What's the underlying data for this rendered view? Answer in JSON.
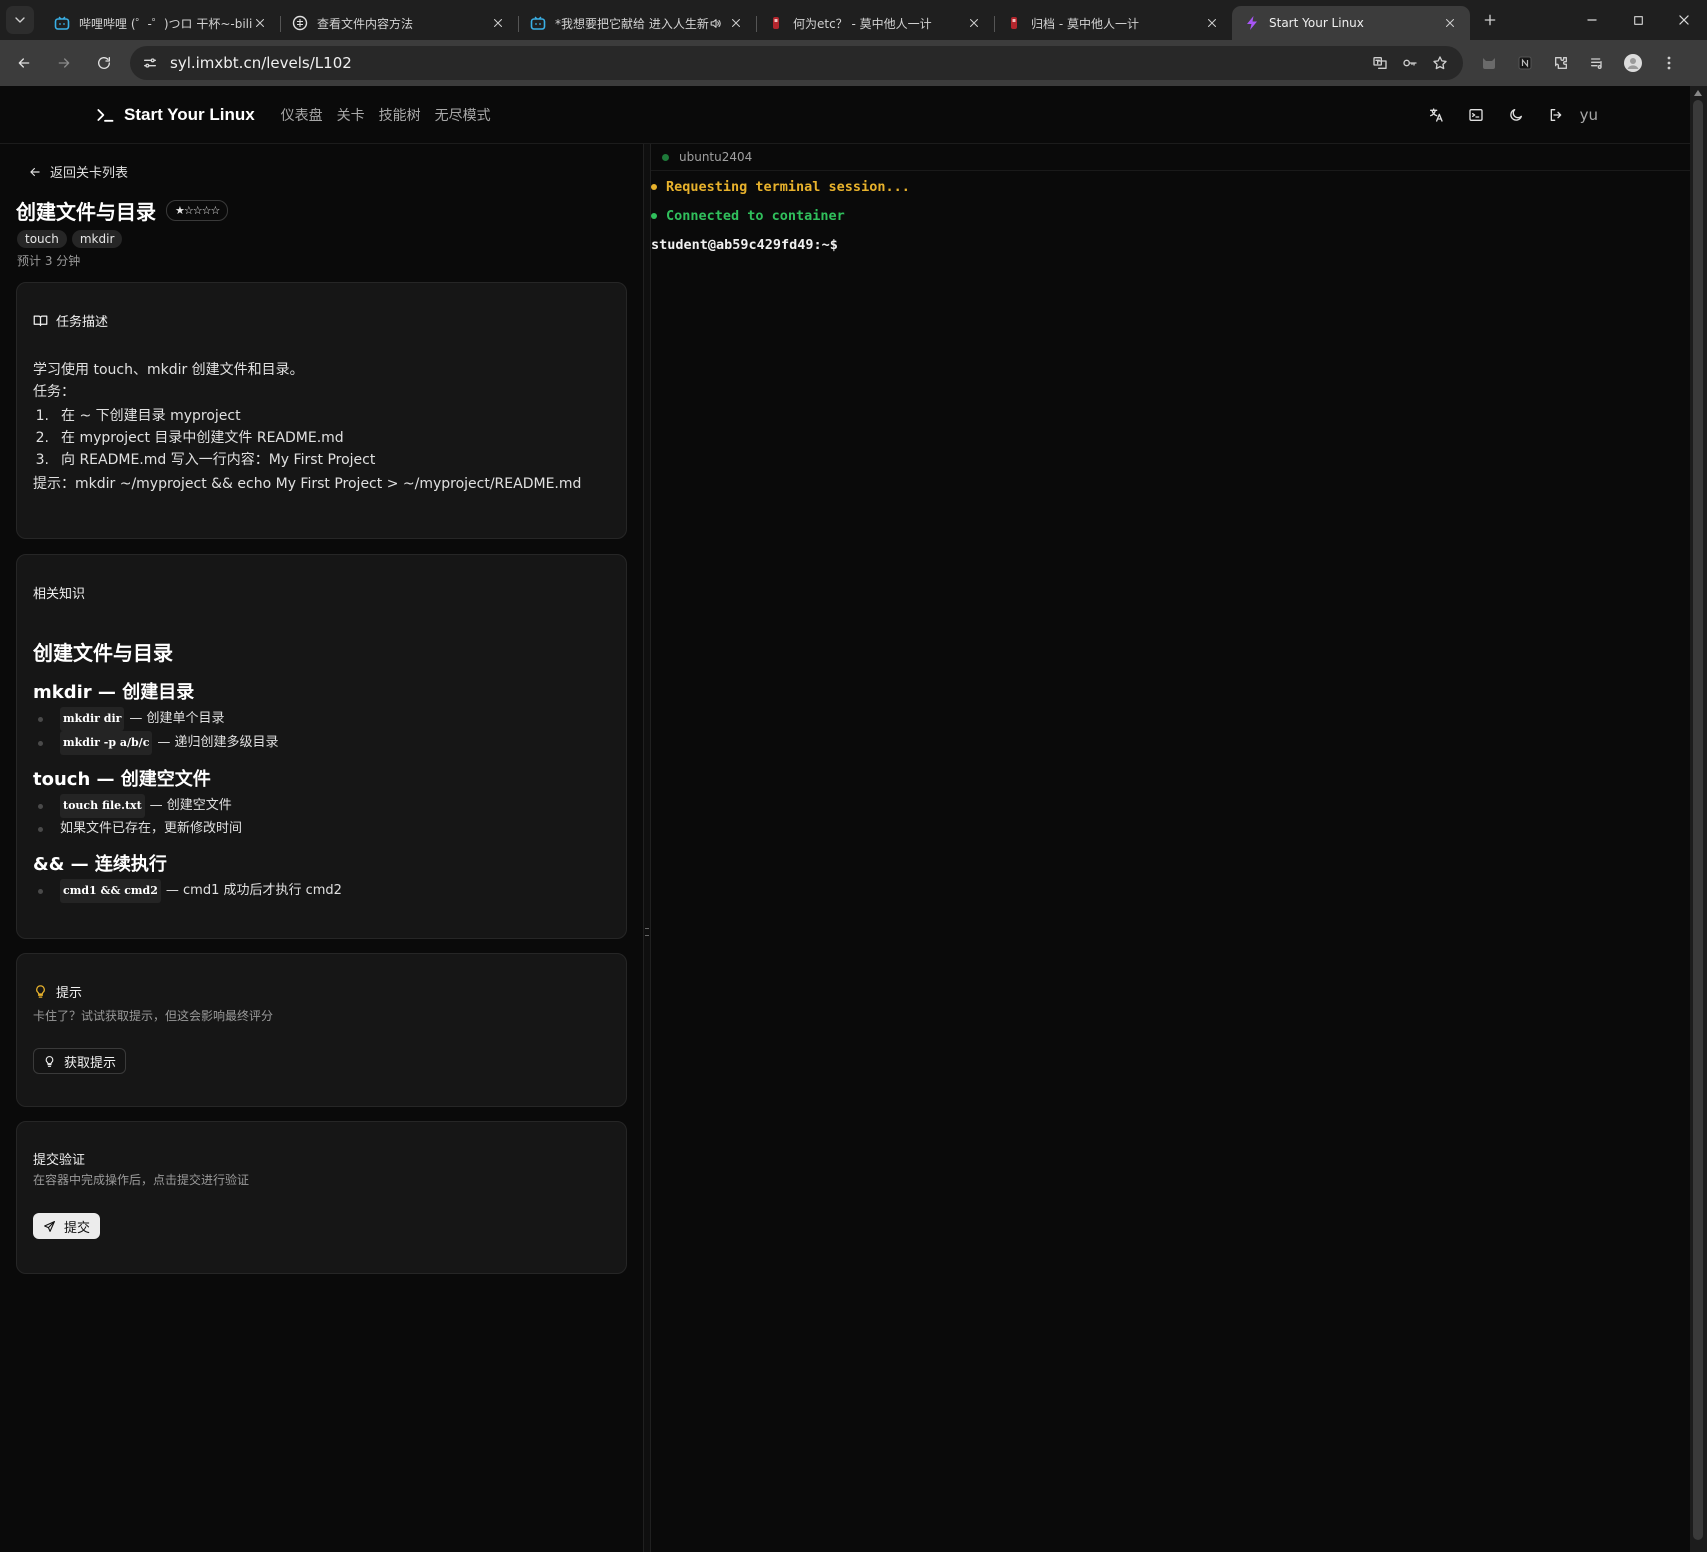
{
  "browser": {
    "tabs": [
      {
        "title": "哔哩哔哩 (゜-゜)つロ 干杯~-bilibili",
        "icon": "bilibili-icon",
        "active": false
      },
      {
        "title": "查看文件内容方法",
        "icon": "chatgpt-icon",
        "active": false
      },
      {
        "title": "*我想要把它献给 进入人生新阶段",
        "icon": "bilibili-icon",
        "active": false,
        "audio": true
      },
      {
        "title": "何为etc？ - 莫中他人一计",
        "icon": "red-site-icon",
        "active": false
      },
      {
        "title": "归档 - 莫中他人一计",
        "icon": "red-site-icon",
        "active": false
      },
      {
        "title": "Start Your Linux",
        "icon": "bolt-icon",
        "active": true
      }
    ],
    "url": "syl.imxbt.cn/levels/L102"
  },
  "header": {
    "brand": "Start Your Linux",
    "nav": [
      "仪表盘",
      "关卡",
      "技能树",
      "无尽模式"
    ],
    "username": "yu"
  },
  "level": {
    "back_label": "返回关卡列表",
    "title": "创建文件与目录",
    "stars": "★☆☆☆☆",
    "tags": [
      "touch",
      "mkdir"
    ],
    "estimate": "预计 3 分钟"
  },
  "task": {
    "heading": "任务描述",
    "intro": "学习使用 touch、mkdir 创建文件和目录。",
    "tasks_label": "任务：",
    "items": [
      {
        "num": "1.",
        "text": "在 ~ 下创建目录 myproject"
      },
      {
        "num": "2.",
        "text": "在 myproject 目录中创建文件 README.md"
      },
      {
        "num": "3.",
        "text": "向 README.md 写入一行内容：My First Project"
      }
    ],
    "tip": "提示：mkdir ~/myproject && echo My First Project > ~/myproject/README.md"
  },
  "knowledge": {
    "heading": "相关知识",
    "title": "创建文件与目录",
    "sections": [
      {
        "title": "mkdir — 创建目录",
        "items": [
          {
            "code": "mkdir dir",
            "text": "— 创建单个目录"
          },
          {
            "code": "mkdir -p a/b/c",
            "text": "— 递归创建多级目录"
          }
        ]
      },
      {
        "title": "touch — 创建空文件",
        "items": [
          {
            "code": "touch file.txt",
            "text": "— 创建空文件"
          },
          {
            "code": "",
            "text": "如果文件已存在，更新修改时间"
          }
        ]
      },
      {
        "title": "&& — 连续执行",
        "items": [
          {
            "code": "cmd1 && cmd2",
            "text": "— cmd1 成功后才执行 cmd2"
          }
        ]
      }
    ]
  },
  "hint": {
    "heading": "提示",
    "subtitle": "卡住了？试试获取提示，但这会影响最终评分",
    "button": "获取提示"
  },
  "submit": {
    "heading": "提交验证",
    "subtitle": "在容器中完成操作后，点击提交进行验证",
    "button": "提交"
  },
  "terminal": {
    "tab": "ubuntu2404",
    "lines": [
      {
        "text": "Requesting terminal session...",
        "color": "#e8b22c",
        "bullet": true
      },
      {
        "text": "Connected to container",
        "color": "#30c05c",
        "bullet": true
      },
      {
        "text": "student@ab59c429fd49:~$",
        "color": "#f0f0f0",
        "bullet": false
      }
    ]
  },
  "colors": {
    "background": "#0a0a0a",
    "card": "#161616",
    "warning": "#e8b22c",
    "success": "#30c05c"
  }
}
